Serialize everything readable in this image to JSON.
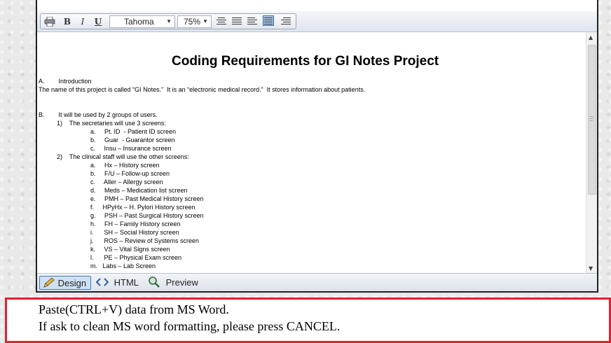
{
  "toolbar": {
    "bold_label": "B",
    "italic_label": "I",
    "underline_label": "U",
    "font_family": "Tahoma",
    "zoom": "75%",
    "alignment_active": "justify"
  },
  "document": {
    "title": "Coding Requirements for GI Notes Project",
    "lines": [
      "A.        Introduction",
      "The name of this project is called “GI Notes.”  It is an “electronic medical record.”  It stores information about patients.",
      "B.        It will be used by 2 groups of users.",
      "1)    The secretaries will use 3 screens:",
      "a.     Pt. ID  - Patient ID screen",
      "b.     Guar  - Guarantor screen",
      "c.     Insu – Insurance screen",
      "2)    The clinical staff will use the other screens:",
      "a.     Hx – History screen",
      "b.     F/U – Follow-up screen",
      "c.     Aller – Allergy screen",
      "d.     Meds – Medication list screen",
      "e.     PMH – Past Medical History screen",
      "f.     HPyHx – H. Pylori History screen",
      "g.     PSH – Past Surgical History screen",
      "h.     FH – Family History screen",
      "i.      SH – Social History screen",
      "j.      ROS – Review of Systems screen",
      "k.     VS – Vital Signs screen",
      "l.      PE – Physical Exam screen",
      "m.   Labs – Lab Screen"
    ]
  },
  "modes": {
    "design": "Design",
    "html": "HTML",
    "preview": "Preview",
    "active": "Design"
  },
  "hint": {
    "line1": "Paste(CTRL+V) data from MS Word.",
    "line2": "If ask to clean MS word formatting, please press CANCEL."
  }
}
